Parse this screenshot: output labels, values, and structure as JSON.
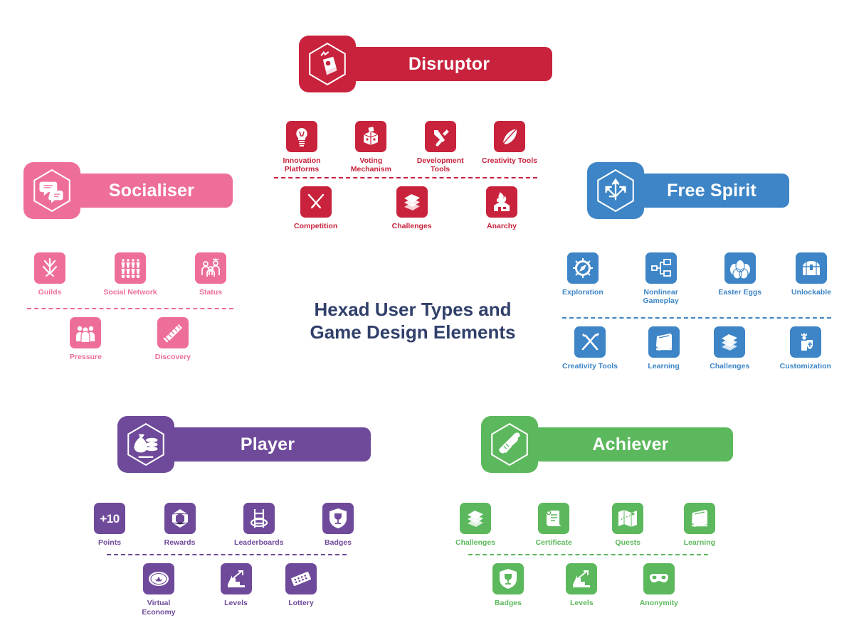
{
  "title": {
    "line1": "Hexad User Types and",
    "line2": "Game Design Elements",
    "color": "#31406b"
  },
  "colors": {
    "disruptor": "#c8223c",
    "socialiser": "#ee6e9a",
    "free_spirit": "#3d85c6",
    "player": "#6f4a9b",
    "achiever": "#5cb85c",
    "title": "#31406b",
    "background": "#ffffff"
  },
  "types": {
    "disruptor": {
      "label": "Disruptor",
      "color": "#c8223c",
      "badge_icon": "bomb-icon",
      "row1": [
        {
          "label": "Innovation Platforms",
          "icon": "lightbulb-icon"
        },
        {
          "label": "Voting Mechanism",
          "icon": "ballot-box-icon"
        },
        {
          "label": "Development Tools",
          "icon": "tools-icon"
        },
        {
          "label": "Creativity Tools",
          "icon": "feather-icon"
        }
      ],
      "row2": [
        {
          "label": "Competition",
          "icon": "crossed-swords-icon"
        },
        {
          "label": "Challenges",
          "icon": "puzzle-stack-icon"
        },
        {
          "label": "Anarchy",
          "icon": "burning-house-icon"
        }
      ]
    },
    "socialiser": {
      "label": "Socialiser",
      "color": "#ee6e9a",
      "badge_icon": "speech-bubbles-icon",
      "row1": [
        {
          "label": "Guilds",
          "icon": "crossed-swords-shield-icon"
        },
        {
          "label": "Social Network",
          "icon": "people-grid-icon"
        },
        {
          "label": "Status",
          "icon": "crowned-people-icon"
        }
      ],
      "row2": [
        {
          "label": "Pressure",
          "icon": "crowd-icon"
        },
        {
          "label": "Discovery",
          "icon": "telescope-icon"
        }
      ]
    },
    "free_spirit": {
      "label": "Free Spirit",
      "color": "#3d85c6",
      "badge_icon": "multi-arrows-icon",
      "row1": [
        {
          "label": "Exploration",
          "icon": "compass-icon"
        },
        {
          "label": "Nonlinear Gameplay",
          "icon": "flowchart-icon"
        },
        {
          "label": "Easter Eggs",
          "icon": "eggs-icon"
        },
        {
          "label": "Unlockable",
          "icon": "treasure-chest-icon"
        }
      ],
      "row2": [
        {
          "label": "Creativity Tools",
          "icon": "brush-pencil-icon"
        },
        {
          "label": "Learning",
          "icon": "books-icon"
        },
        {
          "label": "Challenges",
          "icon": "puzzle-stack-icon"
        },
        {
          "label": "Customization",
          "icon": "knight-icon"
        }
      ]
    },
    "player": {
      "label": "Player",
      "color": "#6f4a9b",
      "badge_icon": "money-bag-icon",
      "row1": [
        {
          "label": "Points",
          "icon": "plus-ten-icon",
          "text": "+10"
        },
        {
          "label": "Rewards",
          "icon": "gem-icon"
        },
        {
          "label": "Leaderboards",
          "icon": "ladder-icon"
        },
        {
          "label": "Badges",
          "icon": "trophy-shield-icon"
        }
      ],
      "row2": [
        {
          "label": "Virtual Economy",
          "icon": "coin-icon"
        },
        {
          "label": "Levels",
          "icon": "stairs-icon"
        },
        {
          "label": "Lottery",
          "icon": "lottery-ticket-icon"
        }
      ]
    },
    "achiever": {
      "label": "Achiever",
      "color": "#5cb85c",
      "badge_icon": "diploma-icon",
      "row1": [
        {
          "label": "Challenges",
          "icon": "puzzle-stack-icon"
        },
        {
          "label": "Certificate",
          "icon": "scroll-icon"
        },
        {
          "label": "Quests",
          "icon": "treasure-map-icon"
        },
        {
          "label": "Learning",
          "icon": "books-icon"
        }
      ],
      "row2": [
        {
          "label": "Badges",
          "icon": "trophy-shield-icon"
        },
        {
          "label": "Levels",
          "icon": "stairs-icon"
        },
        {
          "label": "Anonymity",
          "icon": "mask-icon"
        }
      ]
    }
  }
}
